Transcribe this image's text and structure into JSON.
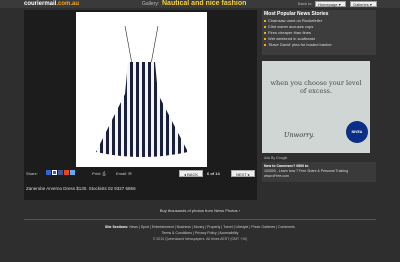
{
  "header": {
    "logo_main": "couriermail",
    "logo_suffix": ".com.au",
    "gallery_label": "Gallery:",
    "gallery_title": "Nautical and nice fashion",
    "back_to": "Back to:",
    "homepage_option": "Homepage",
    "galleries_option": "Galleries"
  },
  "photo": {
    "alt": "Striped strappy dress",
    "caption": "Zanerobe Arverno Dress $130. Stockists 02 9327 6866",
    "share_label": "Share:",
    "print_label": "Print:",
    "email_label": "Email:",
    "back_label": "BACK",
    "counter": "6 of 14",
    "next_label": "NEXT"
  },
  "news": {
    "title": "Most Popular News Stories",
    "items": [
      "Chainsaw used on Rockefeller",
      "Clint owner accuses cops",
      "Fires cheaper than fines",
      "Wet weekend in southeast",
      "'Slave David' plea for busted banker"
    ]
  },
  "ad": {
    "tagline": "when you choose your level of excess.",
    "brand_line": "Unworry.",
    "logo": "NIVEA"
  },
  "ads_by": "Ads By Google",
  "promo": {
    "line1": "New to Commsec? 0800 to",
    "line2": "100000 - Learn how 7 Free Share & Personal Training",
    "line3": "www.xFree.com"
  },
  "buy_text": "Buy thousands of photos from News Photos ›",
  "site_sections": {
    "label": "Site Sections:",
    "items": "News | Sport | Entertainment | Business | Money | Property | Travel | Lifestyle | Photo Galleries | Comments"
  },
  "footer_links": "Terms & Conditions | Privacy Policy | Accessibility",
  "copyright": "© 2010 Queensland Newspapers. All times AEST (GMT +10)"
}
